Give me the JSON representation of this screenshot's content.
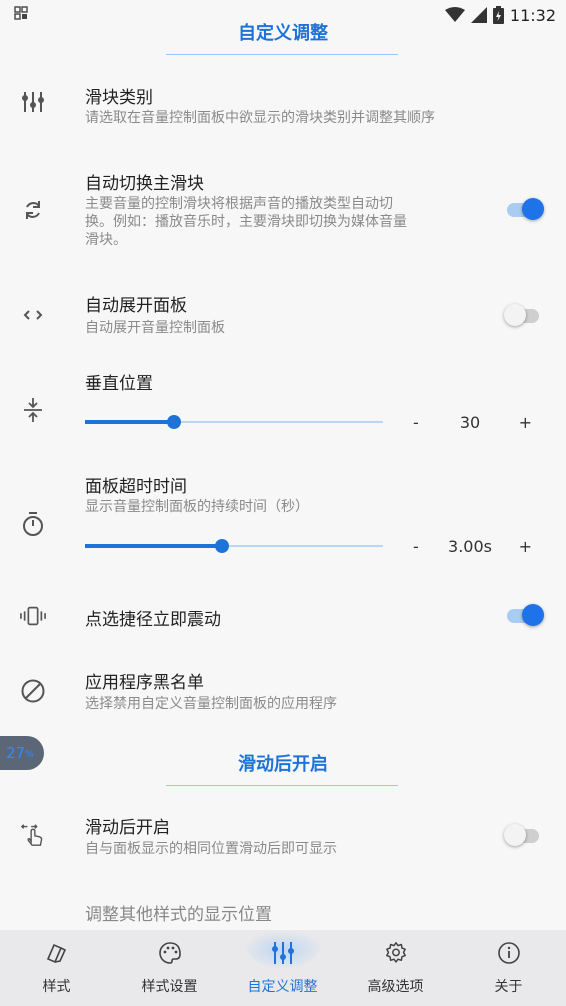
{
  "status_bar": {
    "time": "11:32"
  },
  "section1": {
    "title": "自定义调整"
  },
  "slider_types": {
    "title": "滑块类别",
    "subtitle": "请选取在音量控制面板中欲显示的滑块类别并调整其顺序"
  },
  "auto_switch": {
    "title": "自动切换主滑块",
    "subtitle_lines": [
      "主要音量的控制滑块将根据声音的播放类型自动切",
      "换。例如：播放音乐时，主要滑块即切换为媒体音量",
      "滑块。"
    ],
    "enabled": true
  },
  "auto_expand": {
    "title": "自动展开面板",
    "subtitle": "自动展开音量控制面板",
    "enabled": false
  },
  "vertical_position": {
    "title": "垂直位置",
    "value_label": "30",
    "value": 30,
    "fraction": 0.3,
    "minus": "-",
    "plus": "+"
  },
  "panel_timeout": {
    "title": "面板超时时间",
    "subtitle": "显示音量控制面板的持续时间（秒）",
    "value_label": "3.00s",
    "value": 3.0,
    "fraction": 0.46,
    "minus": "-",
    "plus": "+"
  },
  "shortcut_vibrate": {
    "title": "点选捷径立即震动",
    "enabled": true
  },
  "app_blacklist": {
    "title": "应用程序黑名单",
    "subtitle": "选择禁用自定义音量控制面板的应用程序"
  },
  "floating_badge": {
    "value": "27",
    "unit": "%"
  },
  "section2": {
    "title": "滑动后开启"
  },
  "swipe_open": {
    "title": "滑动后开启",
    "subtitle": "自与面板显示的相同位置滑动后即可显示",
    "enabled": false
  },
  "adjust_other": {
    "title": "调整其他样式的显示位置"
  },
  "bottom_nav": {
    "items": [
      {
        "label": "样式",
        "icon": "style-icon"
      },
      {
        "label": "样式设置",
        "icon": "palette-icon"
      },
      {
        "label": "自定义调整",
        "icon": "sliders-icon",
        "active": true
      },
      {
        "label": "高级选项",
        "icon": "gear-icon"
      },
      {
        "label": "关于",
        "icon": "info-icon"
      }
    ]
  },
  "colors": {
    "accent": "#1e73d8",
    "background": "#f7f7f7",
    "nav_background": "#e9e9eb"
  }
}
